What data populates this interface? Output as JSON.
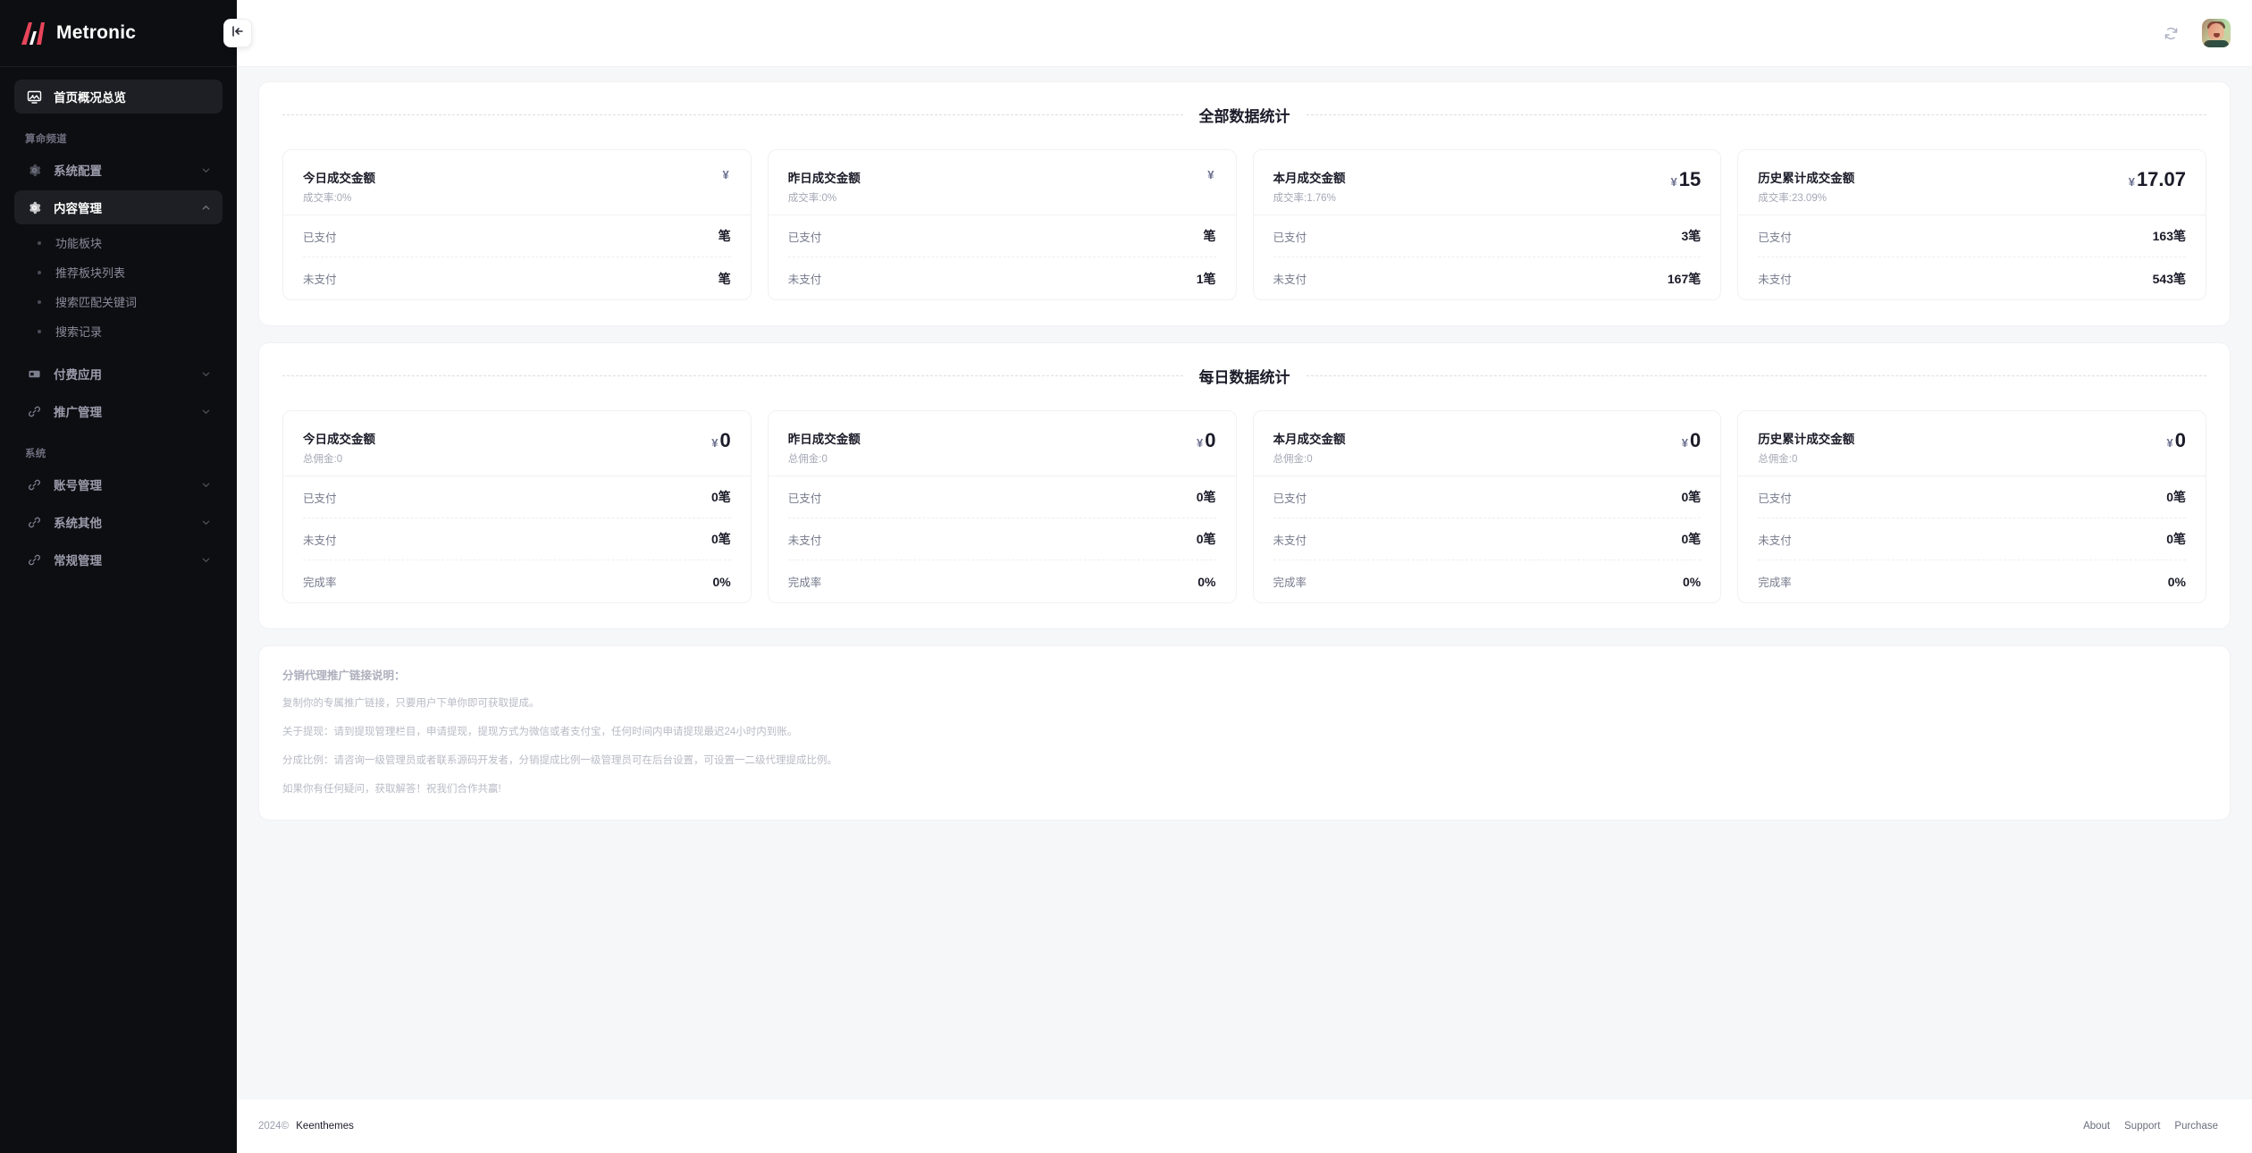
{
  "brand": {
    "name": "Metronic",
    "logo_icon": "metronic-logo-icon",
    "accent": "#e8455a"
  },
  "sidebar": {
    "collapse_icon": "collapse-left-icon",
    "home": {
      "label": "首页概况总览",
      "icon": "dashboard-monitor-icon",
      "active": true
    },
    "groups": [
      {
        "label": "算命频道",
        "items": [
          {
            "label": "系统配置",
            "icon": "gear-icon",
            "arrow": "chevron-down-icon",
            "expanded": false,
            "active": false,
            "children": []
          },
          {
            "label": "内容管理",
            "icon": "gear-icon",
            "arrow": "chevron-up-icon",
            "expanded": true,
            "active": true,
            "children": [
              {
                "label": "功能板块"
              },
              {
                "label": "推荐板块列表"
              },
              {
                "label": "搜索匹配关键词"
              },
              {
                "label": "搜索记录"
              }
            ]
          },
          {
            "label": "付费应用",
            "icon": "card-icon",
            "arrow": "chevron-down-icon",
            "expanded": false,
            "active": false,
            "children": []
          },
          {
            "label": "推广管理",
            "icon": "link-icon",
            "arrow": "chevron-down-icon",
            "expanded": false,
            "active": false,
            "children": []
          }
        ]
      },
      {
        "label": "系统",
        "items": [
          {
            "label": "账号管理",
            "icon": "link-icon",
            "arrow": "chevron-down-icon",
            "expanded": false,
            "active": false,
            "children": []
          },
          {
            "label": "系统其他",
            "icon": "link-icon",
            "arrow": "chevron-down-icon",
            "expanded": false,
            "active": false,
            "children": []
          },
          {
            "label": "常规管理",
            "icon": "link-icon",
            "arrow": "chevron-down-icon",
            "expanded": false,
            "active": false,
            "children": []
          }
        ]
      }
    ]
  },
  "topbar": {
    "refresh_icon": "refresh-circle-icon",
    "avatar_icon": "user-avatar"
  },
  "sections": [
    {
      "title": "全部数据统计",
      "cards": [
        {
          "title": "今日成交金额",
          "subtitle": "成交率:0%",
          "currency": "¥",
          "amount": "",
          "rows": [
            {
              "label": "已支付",
              "value": "笔"
            },
            {
              "label": "未支付",
              "value": "笔"
            }
          ]
        },
        {
          "title": "昨日成交金额",
          "subtitle": "成交率:0%",
          "currency": "¥",
          "amount": "",
          "rows": [
            {
              "label": "已支付",
              "value": "笔"
            },
            {
              "label": "未支付",
              "value": "1笔"
            }
          ]
        },
        {
          "title": "本月成交金额",
          "subtitle": "成交率:1.76%",
          "currency": "¥",
          "amount": "15",
          "rows": [
            {
              "label": "已支付",
              "value": "3笔"
            },
            {
              "label": "未支付",
              "value": "167笔"
            }
          ]
        },
        {
          "title": "历史累计成交金额",
          "subtitle": "成交率:23.09%",
          "currency": "¥",
          "amount": "17.07",
          "rows": [
            {
              "label": "已支付",
              "value": "163笔"
            },
            {
              "label": "未支付",
              "value": "543笔"
            }
          ]
        }
      ]
    },
    {
      "title": "每日数据统计",
      "cards": [
        {
          "title": "今日成交金额",
          "subtitle": "总佣金:0",
          "currency": "¥",
          "amount": "0",
          "rows": [
            {
              "label": "已支付",
              "value": "0笔"
            },
            {
              "label": "未支付",
              "value": "0笔"
            },
            {
              "label": "完成率",
              "value": "0%"
            }
          ]
        },
        {
          "title": "昨日成交金额",
          "subtitle": "总佣金:0",
          "currency": "¥",
          "amount": "0",
          "rows": [
            {
              "label": "已支付",
              "value": "0笔"
            },
            {
              "label": "未支付",
              "value": "0笔"
            },
            {
              "label": "完成率",
              "value": "0%"
            }
          ]
        },
        {
          "title": "本月成交金额",
          "subtitle": "总佣金:0",
          "currency": "¥",
          "amount": "0",
          "rows": [
            {
              "label": "已支付",
              "value": "0笔"
            },
            {
              "label": "未支付",
              "value": "0笔"
            },
            {
              "label": "完成率",
              "value": "0%"
            }
          ]
        },
        {
          "title": "历史累计成交金额",
          "subtitle": "总佣金:0",
          "currency": "¥",
          "amount": "0",
          "rows": [
            {
              "label": "已支付",
              "value": "0笔"
            },
            {
              "label": "未支付",
              "value": "0笔"
            },
            {
              "label": "完成率",
              "value": "0%"
            }
          ]
        }
      ]
    }
  ],
  "notes": {
    "title": "分销代理推广链接说明：",
    "lines": [
      "复制你的专属推广链接，只要用户下单你即可获取提成。",
      "关于提现：请到提现管理栏目，申请提现，提现方式为微信或者支付宝，任何时间内申请提现最迟24小时内到账。",
      "分成比例：请咨询一级管理员或者联系源码开发者，分销提成比例一级管理员可在后台设置，可设置一二级代理提成比例。",
      "如果你有任何疑问，获取解答！祝我们合作共赢!"
    ]
  },
  "footer": {
    "year": "2024©",
    "brand": "Keenthemes",
    "links": [
      {
        "label": "About"
      },
      {
        "label": "Support"
      },
      {
        "label": "Purchase"
      }
    ]
  }
}
